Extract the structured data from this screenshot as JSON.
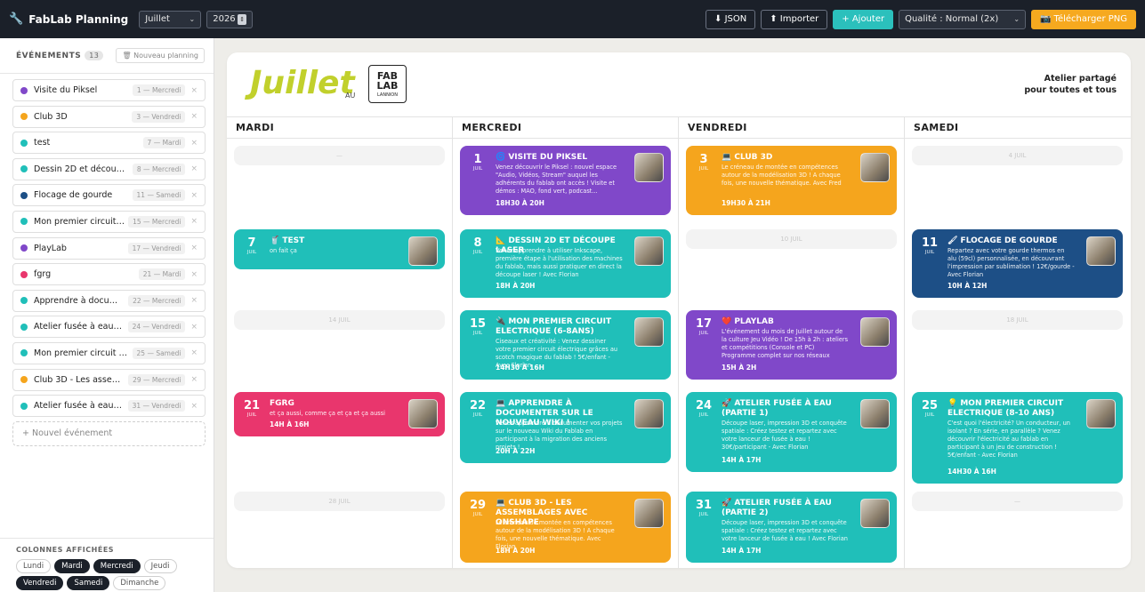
{
  "app": {
    "title": "FabLab Planning",
    "month": "Juillet",
    "year": "2026"
  },
  "toolbar": {
    "json": "⬇ JSON",
    "import": "⬆ Importer",
    "add": "+ Ajouter",
    "quality": "Qualité : Normal (2x)",
    "download": "Télécharger PNG"
  },
  "sidebar": {
    "title": "ÉVÉNEMENTS",
    "count": "13",
    "new_planning": "Nouveau planning",
    "events": [
      {
        "name": "Visite du Piksel",
        "date": "1 — Mercredi",
        "color": "#8048c9"
      },
      {
        "name": "Club 3D",
        "date": "3 — Vendredi",
        "color": "#f5a51d"
      },
      {
        "name": "test",
        "date": "7 — Mardi",
        "color": "#20bfb9"
      },
      {
        "name": "Dessin 2D et découpe laser",
        "date": "8 — Mercredi",
        "color": "#20bfb9"
      },
      {
        "name": "Flocage de gourde",
        "date": "11 — Samedi",
        "color": "#1d4f86"
      },
      {
        "name": "Mon premier circuit elec…",
        "date": "15 — Mercredi",
        "color": "#20bfb9"
      },
      {
        "name": "PlayLab",
        "date": "17 — Vendredi",
        "color": "#8048c9"
      },
      {
        "name": "fgrg",
        "date": "21 — Mardi",
        "color": "#e9366d"
      },
      {
        "name": "Apprendre à documente…",
        "date": "22 — Mercredi",
        "color": "#20bfb9"
      },
      {
        "name": "Atelier fusée à eau (part…",
        "date": "24 — Vendredi",
        "color": "#20bfb9"
      },
      {
        "name": "Mon premier circuit elect…",
        "date": "25 — Samedi",
        "color": "#20bfb9"
      },
      {
        "name": "Club 3D - Les assemblag…",
        "date": "29 — Mercredi",
        "color": "#f5a51d"
      },
      {
        "name": "Atelier fusée à eau (part…",
        "date": "31 — Vendredi",
        "color": "#20bfb9"
      }
    ],
    "add_event": "+ Nouvel événement",
    "columns_title": "COLONNES AFFICHÉES",
    "columns": [
      {
        "label": "Lundi",
        "on": false
      },
      {
        "label": "Mardi",
        "on": true
      },
      {
        "label": "Mercredi",
        "on": true
      },
      {
        "label": "Jeudi",
        "on": false
      },
      {
        "label": "Vendredi",
        "on": true
      },
      {
        "label": "Samedi",
        "on": true
      },
      {
        "label": "Dimanche",
        "on": false
      }
    ]
  },
  "calendar": {
    "month": "Juillet",
    "au": "AU",
    "logo_top": "FAB LAB",
    "logo_bottom": "LANNION",
    "tagline1": "Atelier partagé",
    "tagline2": "pour toutes et tous",
    "days": [
      "MARDI",
      "MERCREDI",
      "VENDREDI",
      "SAMEDI"
    ],
    "empty_labels": [
      "—",
      "4 JUIL",
      "10 JUIL",
      "14 JUIL",
      "18 JUIL",
      "28 JUIL",
      "—"
    ],
    "events": {
      "e1": {
        "day": "1",
        "mon": "JUIL",
        "title": "🌀 VISITE DU PIKSEL",
        "desc": "Venez découvrir le Piksel : nouvel espace \"Audio, Vidéos, Stream\" auquel les adhérents du fablab ont accès ! Visite et démos : MAO, fond vert, podcast...",
        "time": "18H30 À 20H"
      },
      "e3": {
        "day": "3",
        "mon": "JUIL",
        "title": "💻 CLUB 3D",
        "desc": "Le créneau de montée en compétences autour de la modélisation 3D ! A chaque fois, une nouvelle thématique. Avec Fred",
        "time": "19H30 À 21H"
      },
      "e7": {
        "day": "7",
        "mon": "JUIL",
        "title": "🥤 TEST",
        "desc": "on fait ça",
        "time": ""
      },
      "e8": {
        "day": "8",
        "mon": "JUIL",
        "title": "📐 DESSIN 2D ET DÉCOUPE LASER",
        "desc": "Venez apprendre à utiliser Inkscape, première étape à l'utilisation des machines du fablab, mais aussi pratiquer en direct la découpe laser ! Avec Florian",
        "time": "18H À 20H"
      },
      "e11": {
        "day": "11",
        "mon": "JUIL",
        "title": "🖌 FLOCAGE DE GOURDE",
        "desc": "Repartez avec votre gourde thermos en alu (59cl) personnalisée, en découvrant l'impression par sublimation ! 12€/gourde - Avec Florian",
        "time": "10H À 12H"
      },
      "e15": {
        "day": "15",
        "mon": "JUIL",
        "title": "🔌 MON PREMIER CIRCUIT ELECTRIQUE (6-8ANS)",
        "desc": "Ciseaux et créativité : Venez dessiner votre premier circuit électrique grâces au scotch magique du fablab ! 5€/enfant - Avec Florian",
        "time": "14H30 À 16H"
      },
      "e17": {
        "day": "17",
        "mon": "JUIL",
        "title": "❤️ PLAYLAB",
        "desc": "L'événement du mois de Juillet autour de la culture Jeu Vidéo ! De 15h à 2h : ateliers et compétitions (Console et PC) Programme complet sur nos réseaux",
        "time": "15H À 2H"
      },
      "e21": {
        "day": "21",
        "mon": "JUIL",
        "title": "FGRG",
        "desc": "et ça aussi, comme ça et ça et ça aussi",
        "time": "14H À 16H"
      },
      "e22": {
        "day": "22",
        "mon": "JUIL",
        "title": "💻 APPRENDRE À DOCUMENTER SUR LE NOUVEAU WIKI !",
        "desc": "Venez apprendre à documenter vos projets sur le nouveau Wiki du Fablab en participant à la migration des anciens projets !",
        "time": "20H À 22H"
      },
      "e24": {
        "day": "24",
        "mon": "JUIL",
        "title": "🚀 ATELIER FUSÉE À EAU (PARTIE 1)",
        "desc": "Découpe laser, impression 3D et conquête spatiale : Créez testez et repartez avec votre lanceur de fusée à eau ! 30€/participant - Avec Florian",
        "time": "14H À 17H"
      },
      "e25": {
        "day": "25",
        "mon": "JUIL",
        "title": "💡 MON PREMIER CIRCUIT ELECTRIQUE (8-10 ANS)",
        "desc": "C'est quoi l'électricité? Un conducteur, un isolant ? En série, en parallèle ? Venez découvrir l'électricité au fablab en participant à un jeu de construction ! 5€/enfant - Avec Florian",
        "time": "14H30 À 16H"
      },
      "e29": {
        "day": "29",
        "mon": "JUIL",
        "title": "💻 CLUB 3D - LES ASSEMBLAGES AVEC ONSHAPE",
        "desc": "Le créneau de montée en compétences autour de la modélisation 3D ! A chaque fois, une nouvelle thématique. Avec Florian",
        "time": "18H À 20H"
      },
      "e31": {
        "day": "31",
        "mon": "JUIL",
        "title": "🚀 ATELIER FUSÉE À EAU (PARTIE 2)",
        "desc": "Découpe laser, impression 3D et conquête spatiale : Créez testez et repartez avec votre lanceur de fusée à eau ! Avec Florian",
        "time": "14H À 17H"
      }
    }
  }
}
